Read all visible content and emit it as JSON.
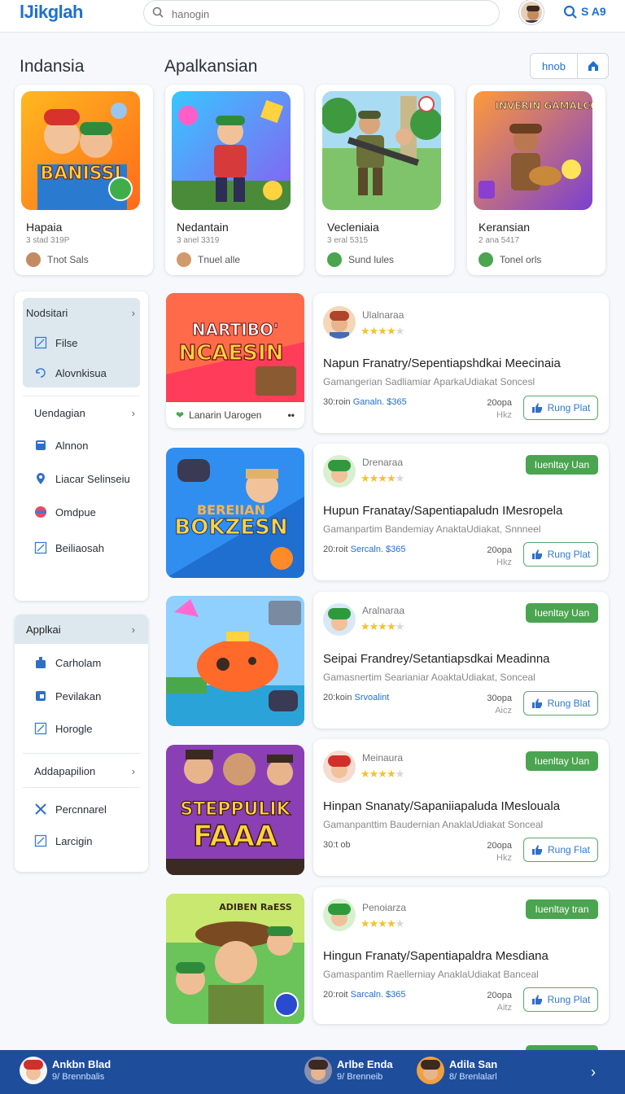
{
  "header": {
    "logo": "lJikglah",
    "search_placeholder": "hanogin",
    "top_label": "S A9"
  },
  "sections": {
    "left_title": "Indansia",
    "main_title": "Apalkansian",
    "segment_label": "hnob"
  },
  "featured": [
    {
      "name": "Hapaia",
      "meta": "3 stad 319P",
      "badge": "Tnot Sals",
      "art_text": "BANISSI"
    },
    {
      "name": "Nedantain",
      "meta": "3 anel 3319",
      "badge": "Tnuel alle",
      "art_text": ""
    },
    {
      "name": "Vecleniaia",
      "meta": "3 eral 5315",
      "badge": "Sund lules",
      "art_text": ""
    },
    {
      "name": "Keransian",
      "meta": "2 ana 5417",
      "badge": "Tonel orls",
      "art_text": "INVERIN GAMALCON"
    }
  ],
  "sidebar1": {
    "items": [
      {
        "label": "Nodsitari"
      },
      {
        "label": "Filse"
      },
      {
        "label": "Alovnkisua"
      },
      {
        "label": "Uendagian"
      },
      {
        "label": "Alnnon"
      },
      {
        "label": "Liacar Selinseiu"
      },
      {
        "label": "Omdpue"
      },
      {
        "label": "Beiliaosah"
      }
    ]
  },
  "sidebar2": {
    "items": [
      {
        "label": "Applkai"
      },
      {
        "label": "Carholam"
      },
      {
        "label": "Pevilakan"
      },
      {
        "label": "Horogle"
      },
      {
        "label": "Addapapilion"
      },
      {
        "label": "Percnnarel"
      },
      {
        "label": "Larcigin"
      }
    ]
  },
  "small_card": {
    "label": "Lanarin Uarogen",
    "more": "••"
  },
  "thumb_texts": [
    "NARTIBO'",
    "NCAESIN",
    "BEREIIAN",
    "BOKZESN",
    "STEPPULIK",
    "FAAA",
    "ADIBEN RaESS"
  ],
  "apps": [
    {
      "dev": "Ulalnaraa",
      "stars": 4,
      "title": "Napun Franatry/Sepentiapshdkai Meecinaia",
      "sub": "Gamangerian Sadliamiar AparkaUdiakat Soncesl",
      "meta_a": "30:roin",
      "meta_b": "Ganaln. $365",
      "size_a": "20opa",
      "size_b": "Hkz",
      "play": "Rung Plat",
      "tag": ""
    },
    {
      "dev": "Drenaraa",
      "stars": 4,
      "title": "Hupun Franatay/Sapentiapaludn IMesropela",
      "sub": "Gamanpartim Bandemiay AnaktaUdiakat, Snnneel",
      "meta_a": "20:roit",
      "meta_b": "Sercaln. $365",
      "size_a": "20opa",
      "size_b": "Hkz",
      "play": "Rung Plat",
      "tag": "Iuenltay Uan"
    },
    {
      "dev": "Aralnaraa",
      "stars": 4,
      "title": "Seipai Frandrey/Setantiapsdkai Meadinna",
      "sub": "Gamasnertim Searianiar AoaktaUdiakat, Sonceal",
      "meta_a": "20:koin",
      "meta_b": "Srvoalint",
      "size_a": "30opa",
      "size_b": "Aicz",
      "play": "Rung Blat",
      "tag": "Iuenltay Uan"
    },
    {
      "dev": "Meinaura",
      "stars": 4,
      "title": "Hinpan Snanaty/Sapaniiapaluda IMeslouala",
      "sub": "Gamanpanttim Baudernian AnaklaUdiakat Sonceal",
      "meta_a": "30:t ob",
      "meta_b": "",
      "size_a": "20opa",
      "size_b": "Hkz",
      "play": "Rung Flat",
      "tag": "Iuenltay Uan"
    },
    {
      "dev": "Penoiarza",
      "stars": 4,
      "title": "Hingun Franaty/Sapentiapaldra Mesdiana",
      "sub": "Gamaspantim Raellerniay AnaklaUdiakat Banceal",
      "meta_a": "20:roit",
      "meta_b": "Sarcaln. $365",
      "size_a": "20opa",
      "size_b": "Aitz",
      "play": "Rung Plat",
      "tag": "Iuenltay tran"
    }
  ],
  "bottom_bar": {
    "users": [
      {
        "name": "Ankbn Blad",
        "status": "9/ Brennbalis"
      },
      {
        "name": "Arlbe Enda",
        "status": "9/ Brenneib"
      },
      {
        "name": "Adila San",
        "status": "8/ Brenlalarl"
      }
    ]
  },
  "colors": {
    "accent": "#1f6fd1",
    "green": "#4ba450",
    "bottom_bar": "#1e4e9b"
  }
}
